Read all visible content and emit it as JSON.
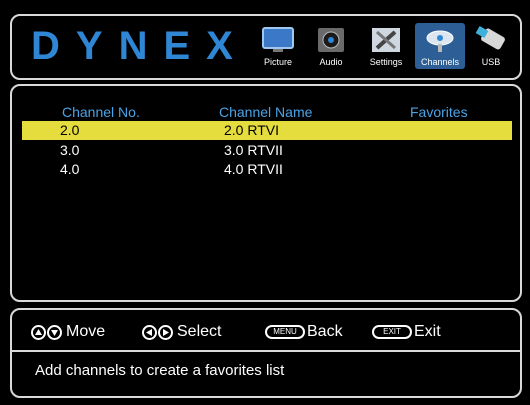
{
  "brand": "DYNEX",
  "menu": [
    {
      "id": "picture",
      "label": "Picture",
      "icon": "tv-icon"
    },
    {
      "id": "audio",
      "label": "Audio",
      "icon": "speaker-icon"
    },
    {
      "id": "settings",
      "label": "Settings",
      "icon": "tools-icon"
    },
    {
      "id": "channels",
      "label": "Channels",
      "icon": "satellite-dish-icon",
      "selected": true
    },
    {
      "id": "usb",
      "label": "USB",
      "icon": "usb-drive-icon"
    }
  ],
  "table": {
    "headers": [
      "Channel No.",
      "Channel Name",
      "Favorites"
    ],
    "rows": [
      {
        "number": "2.0",
        "name": "2.0 RTVI",
        "favorite": "",
        "selected": true
      },
      {
        "number": "3.0",
        "name": "3.0 RTVII",
        "favorite": ""
      },
      {
        "number": "4.0",
        "name": "4.0 RTVII",
        "favorite": ""
      }
    ]
  },
  "hints": {
    "move": "Move",
    "select": "Select",
    "menu_key": "MENU",
    "back": "Back",
    "exit_key": "EXIT",
    "exit": "Exit"
  },
  "message": "Add channels to create a favorites list",
  "colors": {
    "background": "#000000",
    "accent_blue": "#2f86d4",
    "header_text": "#4aa3e6",
    "selected_row": "#e5dc3d",
    "selected_tile": "#2d5f96",
    "panel_border": "#d9d9d9"
  }
}
